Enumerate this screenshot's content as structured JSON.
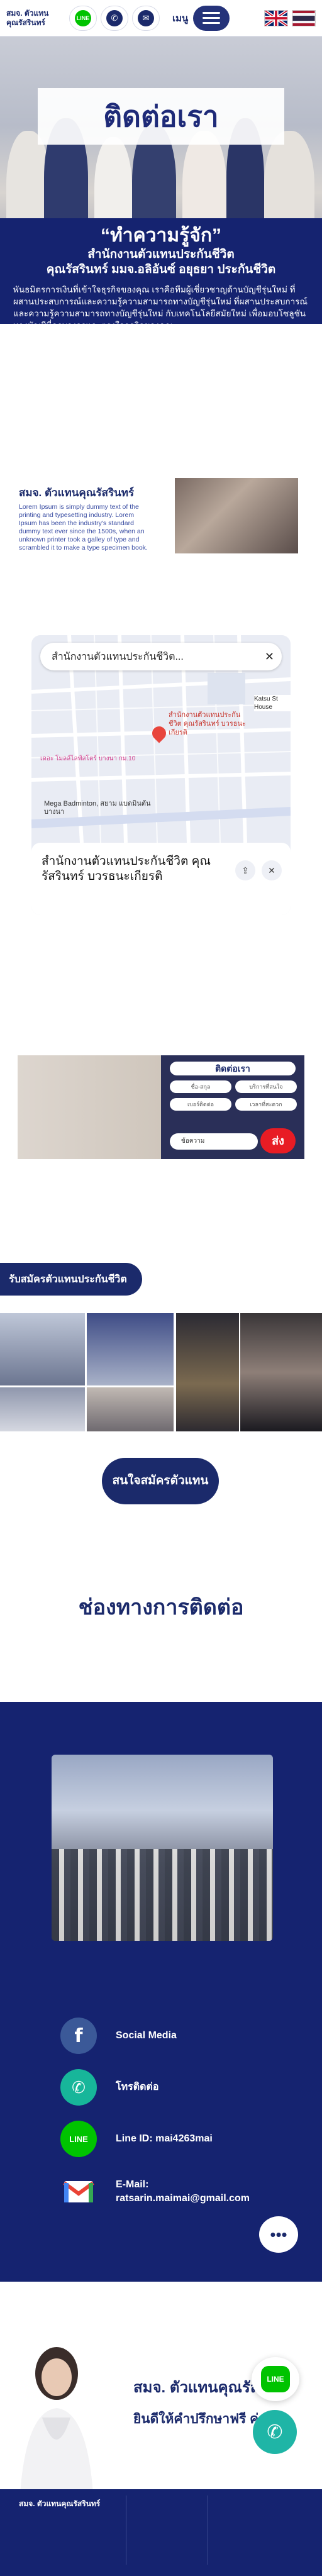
{
  "header": {
    "brand": "สมจ. ตัวแทน\nคุณรัสรินทร์",
    "line_icon": "line-icon",
    "phone_icon": "phone-icon",
    "email_icon": "email-icon",
    "menu_label": "เมนู",
    "flags": [
      "uk-flag-icon",
      "thai-flag-icon"
    ]
  },
  "hero": {
    "title": "ติดต่อเรา"
  },
  "intro": {
    "quote": "“ทำความรู้จัก”",
    "line2": "สำนักงานตัวแทนประกันชีวิต",
    "line3": "คุณรัสรินทร์ มมจ.อลิอันซ์ อยุธยา ประกันชีวิต",
    "paragraph": "พันธมิตรการเงินที่เข้าใจธุรกิจของคุณ เราคือทีมผู้เชี่ยวชาญด้านบัญชีรุ่นใหม่ ที่ผสานประสบการณ์และความรู้ความสามารถทางบัญชีรุ่นใหม่ ที่ผสานประสบการณ์และความรู้ความสามารถทางบัญชีรุ่นใหม่ กับเทคโนโลยีสมัยใหม่ เพื่อมอบโซลูชันทางบัญชีที่ครบวงจรและตรงใจธุรกิจของคุณ"
  },
  "agency": {
    "heading": "สมจ. ตัวแทนคุณรัสรินทร์",
    "paragraph": "Lorem Ipsum is simply dummy text of the printing and typesetting industry. Lorem Ipsum has been the industry's standard dummy text ever since the 1500s, when an unknown printer took a galley of type and scrambled it to make a type specimen book."
  },
  "map": {
    "search_title": "สำนักงานตัวแทนประกันชีวิต...",
    "close": "✕",
    "pin_label": "สำนักงานตัวแทนประกันชีวิต คุณรัสรินทร์ บวรธนะเกียรติ",
    "poi1": "เดอะ โมลล์ไลฟ์สโตร์ บางนา กม.10",
    "poi2": "Mega Badminton, สยาม แบดมินตัน บางนา",
    "poi3": "Katsu St House",
    "card_name": "สำนักงานตัวแทนประกันชีวิต คุณรัสรินทร์ บวรธนะเกียรติ"
  },
  "contact_form": {
    "heading": "ติดต่อเรา",
    "fields": [
      "ชื่อ-สกุล",
      "บริการที่สนใจ",
      "เบอร์ติดต่อ",
      "เวลาที่สะดวก"
    ],
    "message_placeholder": "ข้อความ",
    "send_label": "ส่ง"
  },
  "recruit": {
    "label": "รับสมัครตัวแทนประกันชีวิต",
    "apply_button": "สนใจสมัครตัวแทน"
  },
  "channels": {
    "heading": "ช่องทางการติดต่อ",
    "items": [
      {
        "icon": "facebook-icon",
        "label": "Social Media",
        "color": "#3b5998"
      },
      {
        "icon": "phone-icon",
        "label": "โทรติดต่อ",
        "color": "#17b69a"
      },
      {
        "icon": "line-icon",
        "label": "Line ID: mai4263mai",
        "color": "#00c300"
      },
      {
        "icon": "gmail-icon",
        "label": "E-Mail:\nratsarin.maimai@gmail.com",
        "color": "#ea4335"
      }
    ]
  },
  "promo": {
    "title": "สมจ. ตัวแทนคุณรัสรินทร์",
    "subtitle": "ยินดีให้คำปรึกษาฟรี ค่ะ"
  },
  "footer": {
    "brand": "สมจ. ตัวแทนคุณรัสรินทร์"
  },
  "colors": {
    "navy": "#152370",
    "accent_red": "#e81c24"
  }
}
